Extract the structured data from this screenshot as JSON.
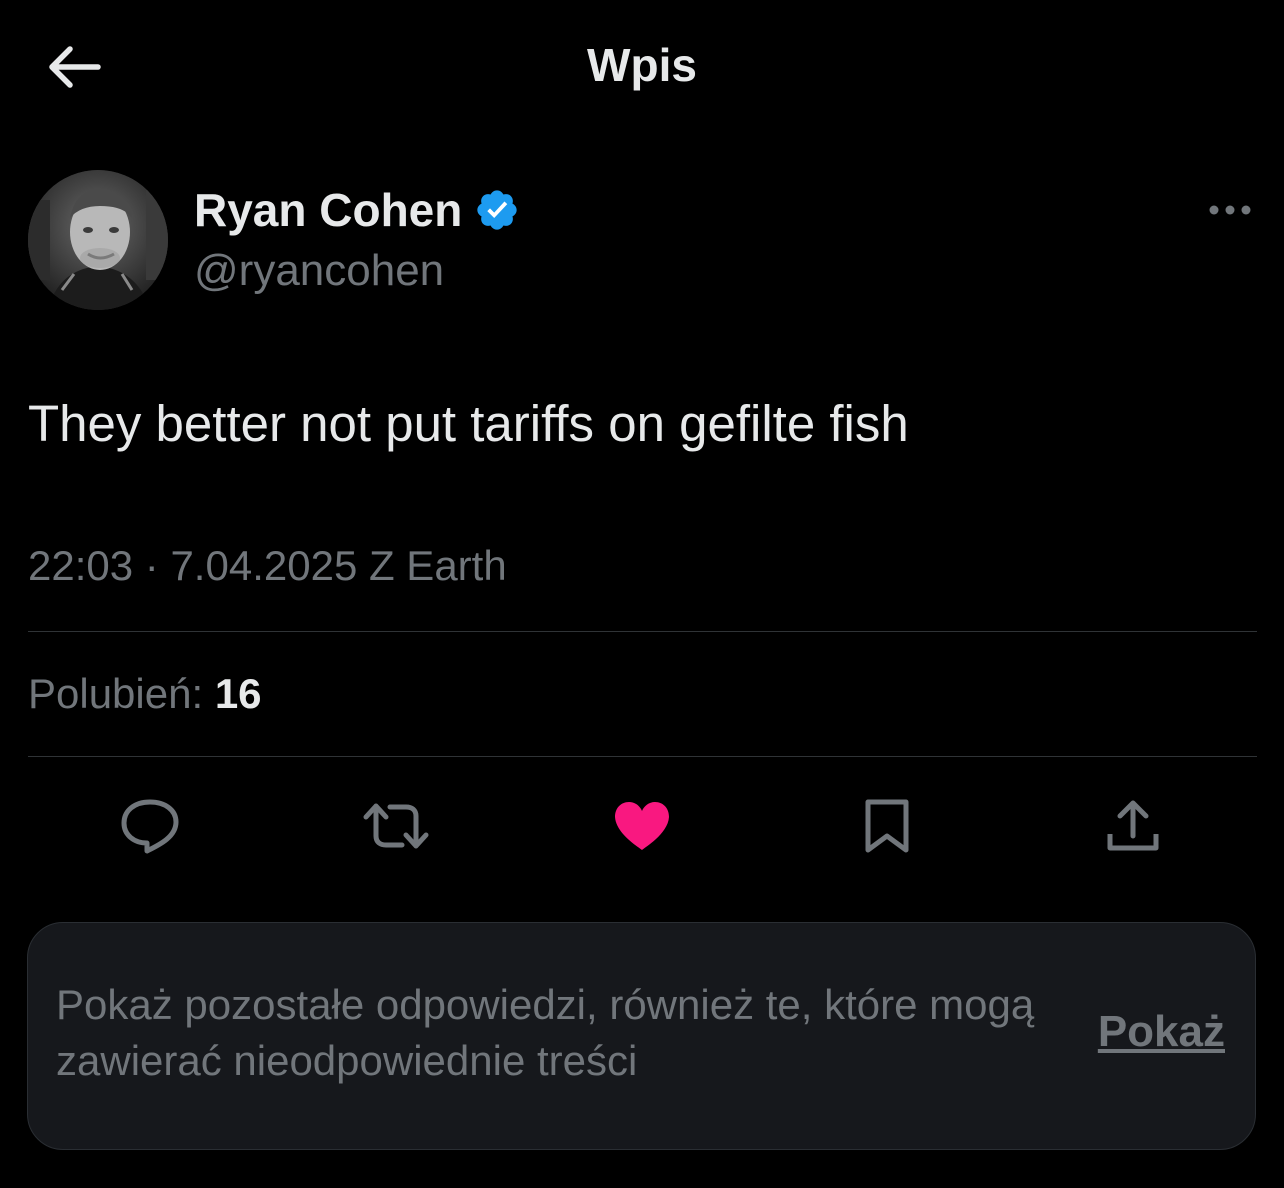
{
  "header": {
    "title": "Wpis",
    "back_icon": "arrow-left-icon"
  },
  "tweet": {
    "author": {
      "display_name": "Ryan Cohen",
      "handle": "@ryancohen",
      "verified": true,
      "verified_color": "#1d9bf0"
    },
    "text": "They better not put tariffs on gefilte fish",
    "time": "22:03",
    "separator": "·",
    "date": "7.04.2025",
    "source": "Z Earth",
    "likes_label": "Polubień:",
    "likes_count": "16"
  },
  "actions": [
    {
      "name": "reply",
      "icon": "reply-bubble-icon"
    },
    {
      "name": "repost",
      "icon": "repost-icon"
    },
    {
      "name": "like",
      "icon": "heart-icon",
      "active": true,
      "color": "#f91880"
    },
    {
      "name": "bookmark",
      "icon": "bookmark-icon"
    },
    {
      "name": "share",
      "icon": "share-icon"
    }
  ],
  "replies_notice": {
    "text": "Pokaż pozostałe odpowiedzi, również te, które mogą zawierać nieodpowiednie treści",
    "button_label": "Pokaż"
  },
  "colors": {
    "background": "#000000",
    "text_primary": "#e7e9ea",
    "text_secondary": "#71767b",
    "divider": "#2f3336",
    "notice_bg": "#16181c"
  }
}
